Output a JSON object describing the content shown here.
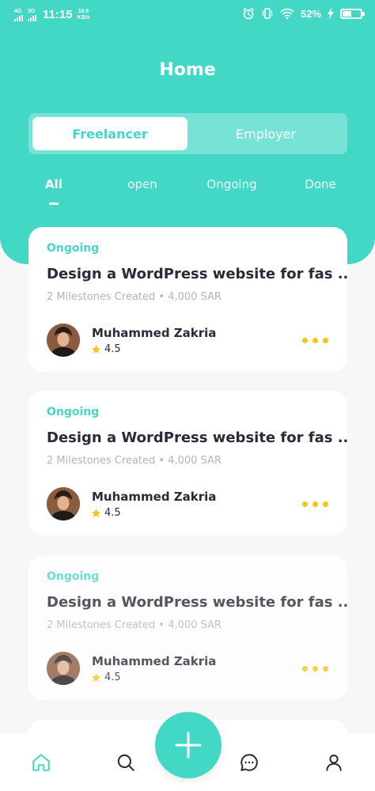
{
  "status_bar": {
    "network1": "4G",
    "network2": "3G",
    "time": "11:15",
    "speed_value": "18.6",
    "speed_unit": "KB/s",
    "battery": "52%",
    "battery_level": 0.52,
    "icons": [
      "alarm-icon",
      "vibrate-icon",
      "wifi-icon",
      "charging-icon",
      "battery-icon"
    ]
  },
  "header": {
    "title": "Home",
    "toggle": {
      "active": "Freelancer",
      "inactive": "Employer"
    }
  },
  "filters": [
    "All",
    "open",
    "Ongoing",
    "Done"
  ],
  "cards": [
    {
      "status": "Ongoing",
      "title": "Design a WordPress website for fas ..",
      "meta": "2 Milestones Created • 4,000 SAR",
      "name": "Muhammed Zakria",
      "rating": "4.5"
    },
    {
      "status": "Ongoing",
      "title": "Design a WordPress website for fas ..",
      "meta": "2 Milestones Created • 4,000 SAR",
      "name": "Muhammed Zakria",
      "rating": "4.5"
    },
    {
      "status": "Ongoing",
      "title": "Design a WordPress website for fas ..",
      "meta": "2 Milestones Created • 4,000 SAR",
      "name": "Muhammed Zakria",
      "rating": "4.5"
    }
  ],
  "colors": {
    "accent": "#43d8c6",
    "star": "#f5c518",
    "text": "#2a2a3a",
    "muted": "#b4b4b4"
  },
  "bottom_nav": [
    "home-icon",
    "search-icon",
    "add-icon",
    "chat-icon",
    "profile-icon"
  ]
}
